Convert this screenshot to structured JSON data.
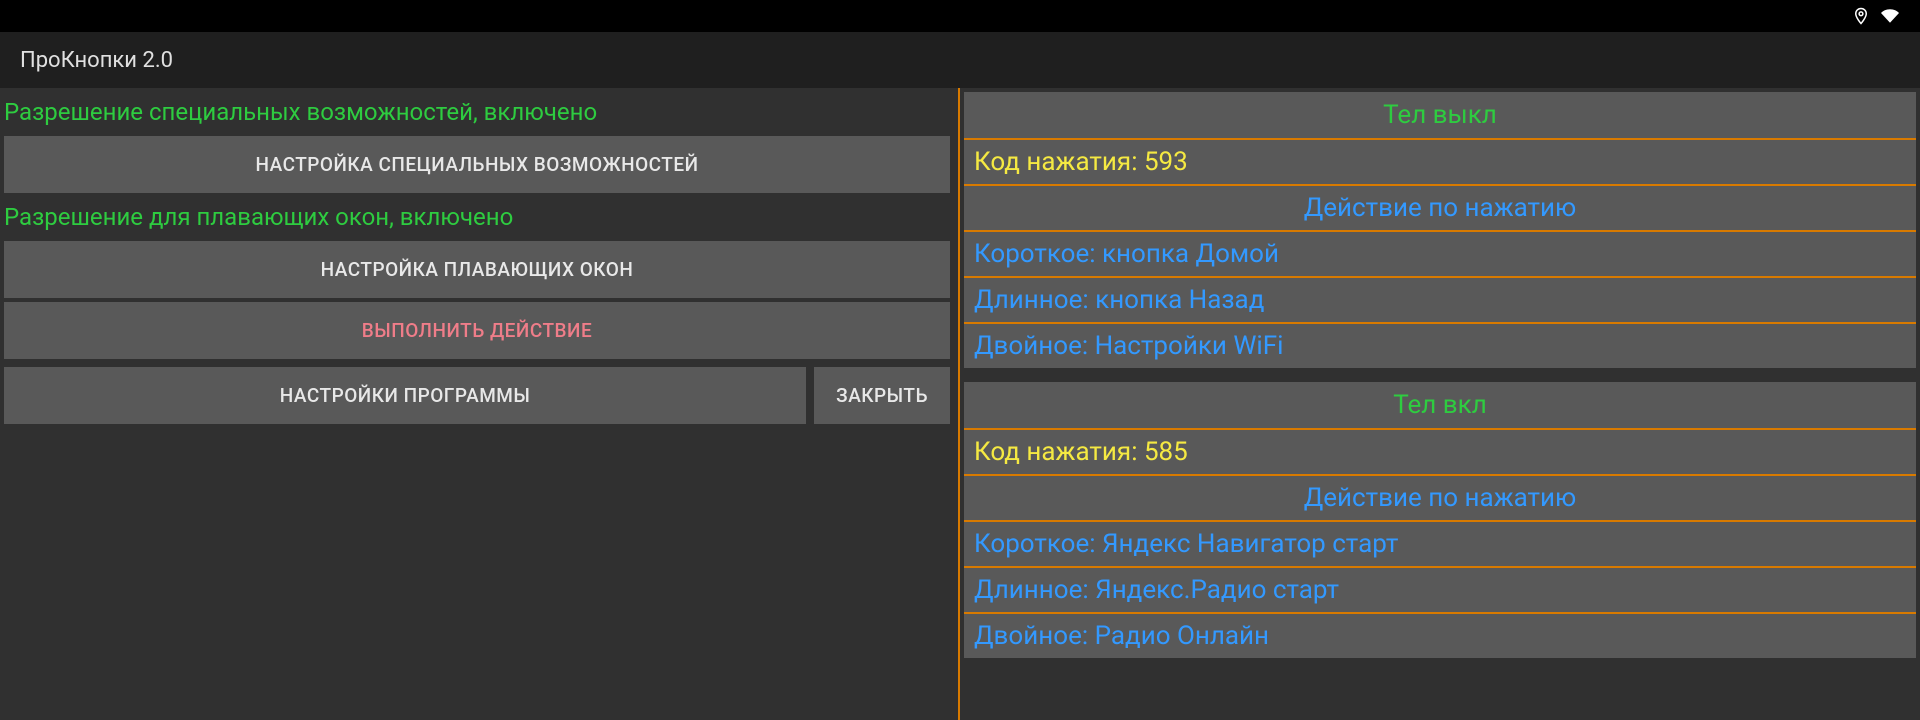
{
  "header": {
    "title": "ПроКнопки 2.0"
  },
  "left": {
    "accessibility_status": "Разрешение специальных возможностей, включено",
    "accessibility_button": "НАСТРОЙКА СПЕЦИАЛЬНЫХ ВОЗМОЖНОСТЕЙ",
    "floating_status": "Разрешение для плавающих окон, включено",
    "floating_button": "НАСТРОЙКА ПЛАВАЮЩИХ ОКОН",
    "execute_button": "ВЫПОЛНИТЬ ДЕЙСТВИЕ",
    "settings_button": "НАСТРОЙКИ ПРОГРАММЫ",
    "close_button": "ЗАКРЫТЬ"
  },
  "right": {
    "cards": [
      {
        "title": "Тел выкл",
        "keycode": "Код нажатия: 593",
        "action_header": "Действие по нажатию",
        "short": "Короткое: кнопка Домой",
        "long": "Длинное: кнопка Назад",
        "double": "Двойное: Настройки WiFi"
      },
      {
        "title": "Тел вкл",
        "keycode": "Код нажатия: 585",
        "action_header": "Действие по нажатию",
        "short": "Короткое: Яндекс Навигатор старт",
        "long": "Длинное: Яндекс.Радио старт",
        "double": "Двойное: Радио Онлайн"
      }
    ]
  }
}
